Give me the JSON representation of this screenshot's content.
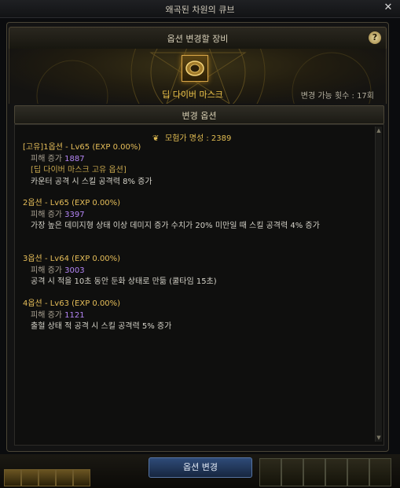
{
  "window": {
    "title": "왜곡된 차원의 큐브",
    "close_label": "✕"
  },
  "equip_header": {
    "title": "옵션 변경할 장비",
    "help_label": "?"
  },
  "item": {
    "name": "딥 다이버 마스크",
    "change_count": "변경 가능 횟수 : 17회"
  },
  "options_header": {
    "title": "변경 옵션"
  },
  "fame": {
    "label": "모험가 명성 : 2389",
    "icon": "fame-crest-icon"
  },
  "options": [
    {
      "head": "[고유]1옵션 - Lv65 (EXP 0.00%)",
      "dmg_label": "피해 증가",
      "dmg_value": "1887",
      "tag": "[딥 다이버 마스크 고유 옵션]",
      "desc": "카운터 공격 시 스킬 공격력 8% 증가"
    },
    {
      "head": "2옵션 - Lv65 (EXP 0.00%)",
      "dmg_label": "피해 증가",
      "dmg_value": "3397",
      "desc": "가장 높은 데미지형 상태 이상 데미지 증가 수치가 20% 미만일 때 스킬 공격력 4% 증가"
    },
    {
      "head": "3옵션 - Lv64 (EXP 0.00%)",
      "dmg_label": "피해 증가",
      "dmg_value": "3003",
      "desc": "공격 시 적을 10초 동안 둔화 상태로 만듦 (쿨타임 15초)"
    },
    {
      "head": "4옵션 - Lv63 (EXP 0.00%)",
      "dmg_label": "피해 증가",
      "dmg_value": "1121",
      "desc": "출혈 상태 적 공격 시 스킬 공격력 5% 증가"
    }
  ],
  "buttons": {
    "change": "옵션 변경"
  },
  "colors": {
    "gold": "#f0c64b",
    "purple": "#b485f5",
    "button_blue": "#2f4b78"
  }
}
